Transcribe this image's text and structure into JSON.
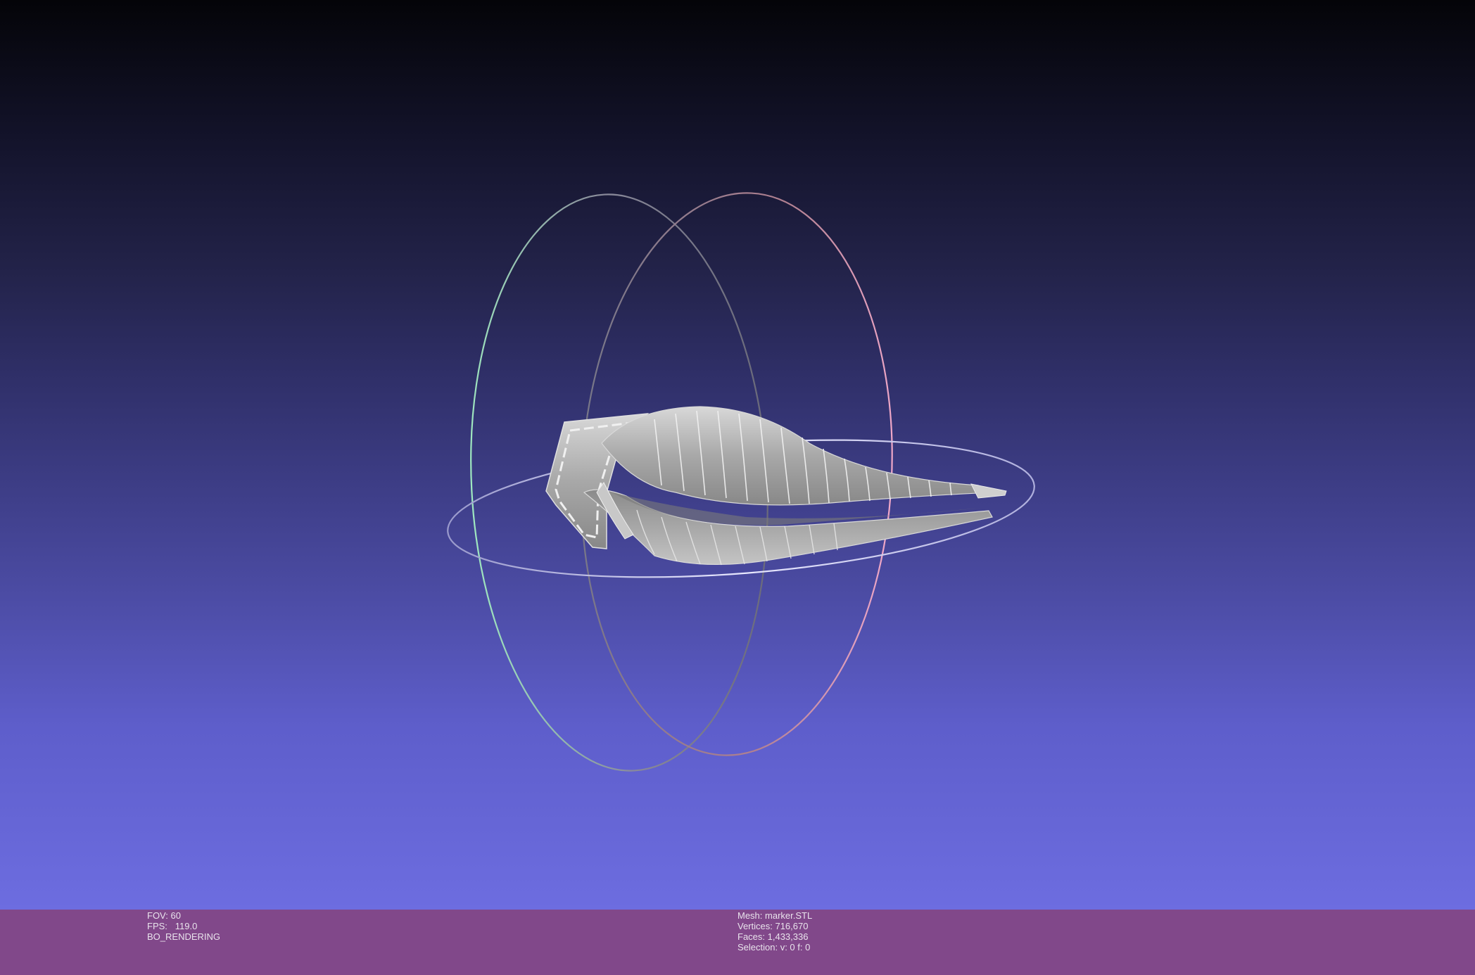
{
  "viewer": {
    "info_left": {
      "fov": "FOV: 60",
      "fps": "FPS:   119.0",
      "render_mode": "BO_RENDERING"
    },
    "info_right": {
      "mesh": "Mesh: marker.STL",
      "vertices": "Vertices: 716,670",
      "faces": "Faces: 1,433,336",
      "selection": "Selection: v: 0 f: 0"
    },
    "colors": {
      "background_top": "#040408",
      "background_bottom": "#6d6de0",
      "info_bar": "#81488a",
      "mesh": "#b8b8b8",
      "trackball_x": "#e38fb0",
      "trackball_y": "#8fe0b8",
      "trackball_z": "#c8c8ff"
    },
    "icons": [
      "trackball-icon",
      "mesh-model"
    ]
  }
}
